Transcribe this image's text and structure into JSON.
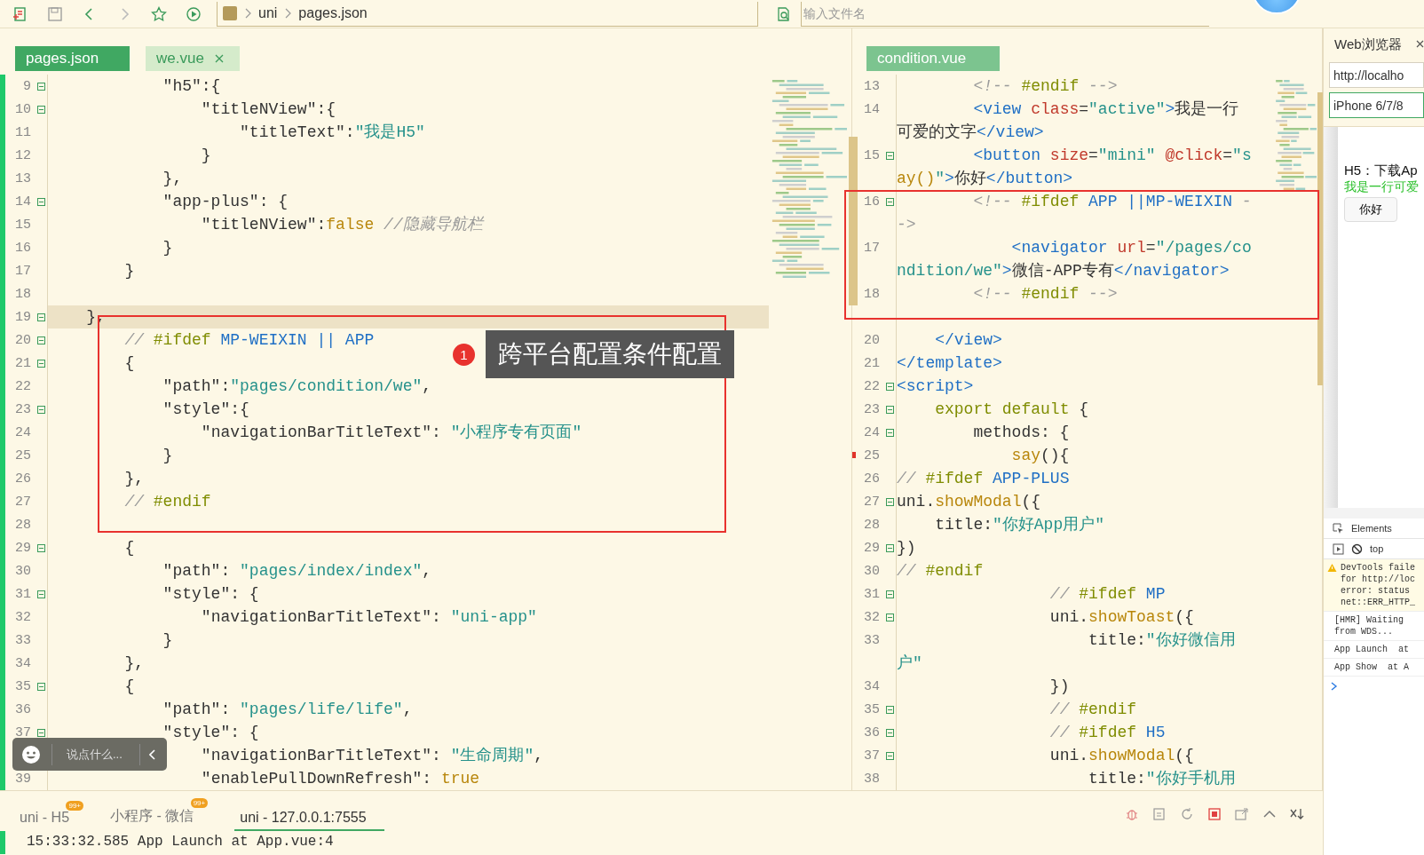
{
  "toolbar": {
    "breadcrumb": [
      {
        "label": "uni"
      },
      {
        "label": "pages.json"
      }
    ],
    "search": {
      "placeholder": "输入文件名"
    }
  },
  "left_editor": {
    "tabs": [
      {
        "label": "pages.json",
        "selected": true,
        "closable": false
      },
      {
        "label": "we.vue",
        "selected": false,
        "closable": true
      }
    ],
    "rows": [
      {
        "number": "9",
        "fold": true,
        "current": false,
        "tokens": [
          {
            "text": "            \"h5\":{",
            "kind": "p"
          }
        ]
      },
      {
        "number": "10",
        "fold": true,
        "current": false,
        "tokens": [
          {
            "text": "                \"titleNView\":{",
            "kind": "p"
          }
        ]
      },
      {
        "number": "11",
        "fold": false,
        "current": false,
        "tokens": [
          {
            "text": "                    \"titleText\":",
            "kind": "p"
          },
          {
            "text": "\"我是H5\"",
            "kind": "s"
          }
        ]
      },
      {
        "number": "12",
        "fold": false,
        "current": false,
        "tokens": [
          {
            "text": "                }",
            "kind": "p"
          }
        ]
      },
      {
        "number": "13",
        "fold": false,
        "current": false,
        "tokens": [
          {
            "text": "            },",
            "kind": "p"
          }
        ]
      },
      {
        "number": "14",
        "fold": true,
        "current": false,
        "tokens": [
          {
            "text": "            \"app-plus\": {",
            "kind": "p"
          }
        ]
      },
      {
        "number": "15",
        "fold": false,
        "current": false,
        "tokens": [
          {
            "text": "                \"titleNView\":",
            "kind": "p"
          },
          {
            "text": "false",
            "kind": "b"
          },
          {
            "text": " //隐藏导航栏",
            "kind": "c"
          }
        ]
      },
      {
        "number": "16",
        "fold": false,
        "current": false,
        "tokens": [
          {
            "text": "            }",
            "kind": "p"
          }
        ]
      },
      {
        "number": "17",
        "fold": false,
        "current": false,
        "tokens": [
          {
            "text": "        }",
            "kind": "p"
          }
        ]
      },
      {
        "number": "18",
        "fold": false,
        "current": false,
        "tokens": []
      },
      {
        "number": "19",
        "fold": true,
        "current": true,
        "tokens": [
          {
            "text": "    },",
            "kind": "p"
          }
        ]
      },
      {
        "number": "20",
        "fold": true,
        "current": false,
        "tokens": [
          {
            "text": "        // ",
            "kind": "c"
          },
          {
            "text": "#ifdef",
            "kind": "d"
          },
          {
            "text": " MP-WEIXIN || APP",
            "kind": "m"
          }
        ]
      },
      {
        "number": "21",
        "fold": true,
        "current": false,
        "tokens": [
          {
            "text": "        {",
            "kind": "p"
          }
        ]
      },
      {
        "number": "22",
        "fold": false,
        "current": false,
        "tokens": [
          {
            "text": "            \"path\":",
            "kind": "p"
          },
          {
            "text": "\"pages/condition/we\"",
            "kind": "s"
          },
          {
            "text": ",",
            "kind": "p"
          }
        ]
      },
      {
        "number": "23",
        "fold": true,
        "current": false,
        "tokens": [
          {
            "text": "            \"style\":{",
            "kind": "p"
          }
        ]
      },
      {
        "number": "24",
        "fold": false,
        "current": false,
        "tokens": [
          {
            "text": "                \"navigationBarTitleText\": ",
            "kind": "p"
          },
          {
            "text": "\"小程序专有页面\"",
            "kind": "s"
          }
        ]
      },
      {
        "number": "25",
        "fold": false,
        "current": false,
        "tokens": [
          {
            "text": "            }",
            "kind": "p"
          }
        ]
      },
      {
        "number": "26",
        "fold": false,
        "current": false,
        "tokens": [
          {
            "text": "        },",
            "kind": "p"
          }
        ]
      },
      {
        "number": "27",
        "fold": false,
        "current": false,
        "tokens": [
          {
            "text": "        // ",
            "kind": "c"
          },
          {
            "text": "#endif",
            "kind": "d"
          }
        ]
      },
      {
        "number": "28",
        "fold": false,
        "current": false,
        "tokens": []
      },
      {
        "number": "29",
        "fold": true,
        "current": false,
        "tokens": [
          {
            "text": "        {",
            "kind": "p"
          }
        ]
      },
      {
        "number": "30",
        "fold": false,
        "current": false,
        "tokens": [
          {
            "text": "            \"path\": ",
            "kind": "p"
          },
          {
            "text": "\"pages/index/index\"",
            "kind": "s"
          },
          {
            "text": ",",
            "kind": "p"
          }
        ]
      },
      {
        "number": "31",
        "fold": true,
        "current": false,
        "tokens": [
          {
            "text": "            \"style\": {",
            "kind": "p"
          }
        ]
      },
      {
        "number": "32",
        "fold": false,
        "current": false,
        "tokens": [
          {
            "text": "                \"navigationBarTitleText\": ",
            "kind": "p"
          },
          {
            "text": "\"uni-app\"",
            "kind": "s"
          }
        ]
      },
      {
        "number": "33",
        "fold": false,
        "current": false,
        "tokens": [
          {
            "text": "            }",
            "kind": "p"
          }
        ]
      },
      {
        "number": "34",
        "fold": false,
        "current": false,
        "tokens": [
          {
            "text": "        },",
            "kind": "p"
          }
        ]
      },
      {
        "number": "35",
        "fold": true,
        "current": false,
        "tokens": [
          {
            "text": "        {",
            "kind": "p"
          }
        ]
      },
      {
        "number": "36",
        "fold": false,
        "current": false,
        "tokens": [
          {
            "text": "            \"path\": ",
            "kind": "p"
          },
          {
            "text": "\"pages/life/life\"",
            "kind": "s"
          },
          {
            "text": ",",
            "kind": "p"
          }
        ]
      },
      {
        "number": "37",
        "fold": true,
        "current": false,
        "tokens": [
          {
            "text": "            \"style\": {",
            "kind": "p"
          }
        ]
      },
      {
        "fold": false,
        "current": false,
        "tokens": [
          {
            "text": "                \"navigationBarTitleText\": ",
            "kind": "p"
          },
          {
            "text": "\"生命周期\"",
            "kind": "s"
          },
          {
            "text": ",",
            "kind": "p"
          }
        ]
      },
      {
        "number": "39",
        "fold": false,
        "current": false,
        "tokens": [
          {
            "text": "                \"enablePullDownRefresh\": ",
            "kind": "p"
          },
          {
            "text": "true",
            "kind": "b"
          }
        ]
      }
    ]
  },
  "right_editor": {
    "tabs": [
      {
        "label": "condition.vue",
        "selected": true,
        "closable": false
      }
    ],
    "rows": [
      {
        "number": "13",
        "fold": false,
        "marker": false,
        "tokens": [
          {
            "text": "        <!-- ",
            "kind": "c"
          },
          {
            "text": "#endif",
            "kind": "d"
          },
          {
            "text": " -->",
            "kind": "c"
          }
        ]
      },
      {
        "number": "14",
        "fold": false,
        "marker": false,
        "tokens": [
          {
            "text": "        <view",
            "kind": "t"
          },
          {
            "text": " class",
            "kind": "a"
          },
          {
            "text": "=",
            "kind": "p"
          },
          {
            "text": "\"active\"",
            "kind": "s"
          },
          {
            "text": ">",
            "kind": "t"
          },
          {
            "text": "我是一行",
            "kind": "p"
          }
        ]
      },
      {
        "fold": false,
        "marker": false,
        "tokens": [
          {
            "text": "可爱的文字",
            "kind": "p"
          },
          {
            "text": "</view>",
            "kind": "t"
          }
        ]
      },
      {
        "number": "15",
        "fold": true,
        "marker": false,
        "tokens": [
          {
            "text": "        <button",
            "kind": "t"
          },
          {
            "text": " size",
            "kind": "a"
          },
          {
            "text": "=",
            "kind": "p"
          },
          {
            "text": "\"mini\"",
            "kind": "s"
          },
          {
            "text": " @click",
            "kind": "a"
          },
          {
            "text": "=",
            "kind": "p"
          },
          {
            "text": "\"s",
            "kind": "s"
          }
        ]
      },
      {
        "fold": false,
        "marker": false,
        "tokens": [
          {
            "text": "ay()",
            "kind": "b"
          },
          {
            "text": "\"",
            "kind": "s"
          },
          {
            "text": ">",
            "kind": "t"
          },
          {
            "text": "你好",
            "kind": "p"
          },
          {
            "text": "</button>",
            "kind": "t"
          }
        ]
      },
      {
        "number": "16",
        "fold": true,
        "marker": false,
        "tokens": [
          {
            "text": "        <!-- ",
            "kind": "c"
          },
          {
            "text": "#ifdef",
            "kind": "d"
          },
          {
            "text": " APP ||MP-WEIXIN",
            "kind": "m"
          },
          {
            "text": " -",
            "kind": "c"
          }
        ]
      },
      {
        "fold": false,
        "marker": false,
        "tokens": [
          {
            "text": "->",
            "kind": "c"
          }
        ]
      },
      {
        "number": "17",
        "fold": false,
        "marker": false,
        "tokens": [
          {
            "text": "            <navigator",
            "kind": "t"
          },
          {
            "text": " url",
            "kind": "a"
          },
          {
            "text": "=",
            "kind": "p"
          },
          {
            "text": "\"/pages/co",
            "kind": "s"
          }
        ]
      },
      {
        "fold": false,
        "marker": false,
        "tokens": [
          {
            "text": "ndition/we\"",
            "kind": "s"
          },
          {
            "text": ">",
            "kind": "t"
          },
          {
            "text": "微信-APP专有",
            "kind": "p"
          },
          {
            "text": "</navigator>",
            "kind": "t"
          }
        ]
      },
      {
        "number": "18",
        "fold": false,
        "marker": false,
        "tokens": [
          {
            "text": "        <!-- ",
            "kind": "c"
          },
          {
            "text": "#endif",
            "kind": "d"
          },
          {
            "text": " -->",
            "kind": "c"
          }
        ]
      },
      {
        "fold": false,
        "marker": false,
        "tokens": []
      },
      {
        "number": "20",
        "fold": false,
        "marker": false,
        "tokens": [
          {
            "text": "    </view>",
            "kind": "t"
          }
        ]
      },
      {
        "number": "21",
        "fold": false,
        "marker": false,
        "tokens": [
          {
            "text": "</template>",
            "kind": "t"
          }
        ]
      },
      {
        "number": "22",
        "fold": true,
        "marker": false,
        "tokens": [
          {
            "text": "<script>",
            "kind": "t"
          }
        ]
      },
      {
        "number": "23",
        "fold": true,
        "marker": false,
        "tokens": [
          {
            "text": "    export default",
            "kind": "d"
          },
          {
            "text": " {",
            "kind": "p"
          }
        ]
      },
      {
        "number": "24",
        "fold": true,
        "marker": false,
        "tokens": [
          {
            "text": "        methods: {",
            "kind": "p"
          }
        ]
      },
      {
        "number": "25",
        "fold": false,
        "marker": true,
        "tokens": [
          {
            "text": "            say",
            "kind": "b"
          },
          {
            "text": "(){",
            "kind": "p"
          }
        ]
      },
      {
        "number": "26",
        "fold": false,
        "marker": false,
        "tokens": [
          {
            "text": "// ",
            "kind": "c"
          },
          {
            "text": "#ifdef",
            "kind": "d"
          },
          {
            "text": " APP-PLUS",
            "kind": "m"
          }
        ]
      },
      {
        "number": "27",
        "fold": true,
        "marker": false,
        "tokens": [
          {
            "text": "uni.",
            "kind": "p"
          },
          {
            "text": "showModal",
            "kind": "b"
          },
          {
            "text": "({",
            "kind": "p"
          }
        ]
      },
      {
        "number": "28",
        "fold": false,
        "marker": false,
        "tokens": [
          {
            "text": "    title:",
            "kind": "p"
          },
          {
            "text": "\"你好App用户\"",
            "kind": "s"
          }
        ]
      },
      {
        "number": "29",
        "fold": true,
        "marker": false,
        "tokens": [
          {
            "text": "})",
            "kind": "p"
          }
        ]
      },
      {
        "number": "30",
        "fold": false,
        "marker": false,
        "tokens": [
          {
            "text": "// ",
            "kind": "c"
          },
          {
            "text": "#endif",
            "kind": "d"
          }
        ]
      },
      {
        "number": "31",
        "fold": true,
        "marker": false,
        "tokens": [
          {
            "text": "                // ",
            "kind": "c"
          },
          {
            "text": "#ifdef",
            "kind": "d"
          },
          {
            "text": " MP",
            "kind": "m"
          }
        ]
      },
      {
        "number": "32",
        "fold": true,
        "marker": false,
        "tokens": [
          {
            "text": "                uni.",
            "kind": "p"
          },
          {
            "text": "showToast",
            "kind": "b"
          },
          {
            "text": "({",
            "kind": "p"
          }
        ]
      },
      {
        "number": "33",
        "fold": false,
        "marker": false,
        "tokens": [
          {
            "text": "                    title:",
            "kind": "p"
          },
          {
            "text": "\"你好微信用",
            "kind": "s"
          }
        ]
      },
      {
        "fold": false,
        "marker": false,
        "tokens": [
          {
            "text": "户\"",
            "kind": "s"
          }
        ]
      },
      {
        "number": "34",
        "fold": false,
        "marker": false,
        "tokens": [
          {
            "text": "                })",
            "kind": "p"
          }
        ]
      },
      {
        "number": "35",
        "fold": true,
        "marker": false,
        "tokens": [
          {
            "text": "                // ",
            "kind": "c"
          },
          {
            "text": "#endif",
            "kind": "d"
          }
        ]
      },
      {
        "number": "36",
        "fold": true,
        "marker": false,
        "tokens": [
          {
            "text": "                // ",
            "kind": "c"
          },
          {
            "text": "#ifdef",
            "kind": "d"
          },
          {
            "text": " H5",
            "kind": "m"
          }
        ]
      },
      {
        "number": "37",
        "fold": true,
        "marker": false,
        "tokens": [
          {
            "text": "                uni.",
            "kind": "p"
          },
          {
            "text": "showModal",
            "kind": "b"
          },
          {
            "text": "({",
            "kind": "p"
          }
        ]
      },
      {
        "number": "38",
        "fold": false,
        "marker": false,
        "tokens": [
          {
            "text": "                    title:",
            "kind": "p"
          },
          {
            "text": "\"你好手机用",
            "kind": "s"
          }
        ]
      }
    ]
  },
  "annotation": {
    "number": "1",
    "text": "跨平台配置条件配置"
  },
  "chat_widget": {
    "placeholder": "说点什么..."
  },
  "browser": {
    "title": "Web浏览器",
    "url": "http://localho",
    "device": "iPhone 6/7/8",
    "preview": {
      "heading": "H5：下载Ap",
      "active_text": "我是一行可爱",
      "button": "你好"
    }
  },
  "devtools": {
    "tab": "Elements",
    "context": "top",
    "messages": [
      {
        "kind": "warning",
        "lines": [
          "DevTools faile",
          "for http://loc",
          "error: status",
          "net::ERR_HTTP_"
        ]
      },
      {
        "kind": "log",
        "lines": [
          "[HMR] Waiting",
          "from WDS..."
        ]
      },
      {
        "kind": "log",
        "lines": [
          "App Launch  at"
        ]
      },
      {
        "kind": "log",
        "lines": [
          "App Show  at A"
        ]
      }
    ]
  },
  "bottom_panel": {
    "tabs": [
      {
        "label": "uni - H5",
        "badge": "99+",
        "selected": false
      },
      {
        "label": "小程序 - 微信",
        "badge": "99+",
        "selected": false
      },
      {
        "label": "uni - 127.0.0.1:7555",
        "selected": true
      }
    ],
    "console": [
      "15:33:32.585 App Launch at App.vue:4"
    ]
  }
}
